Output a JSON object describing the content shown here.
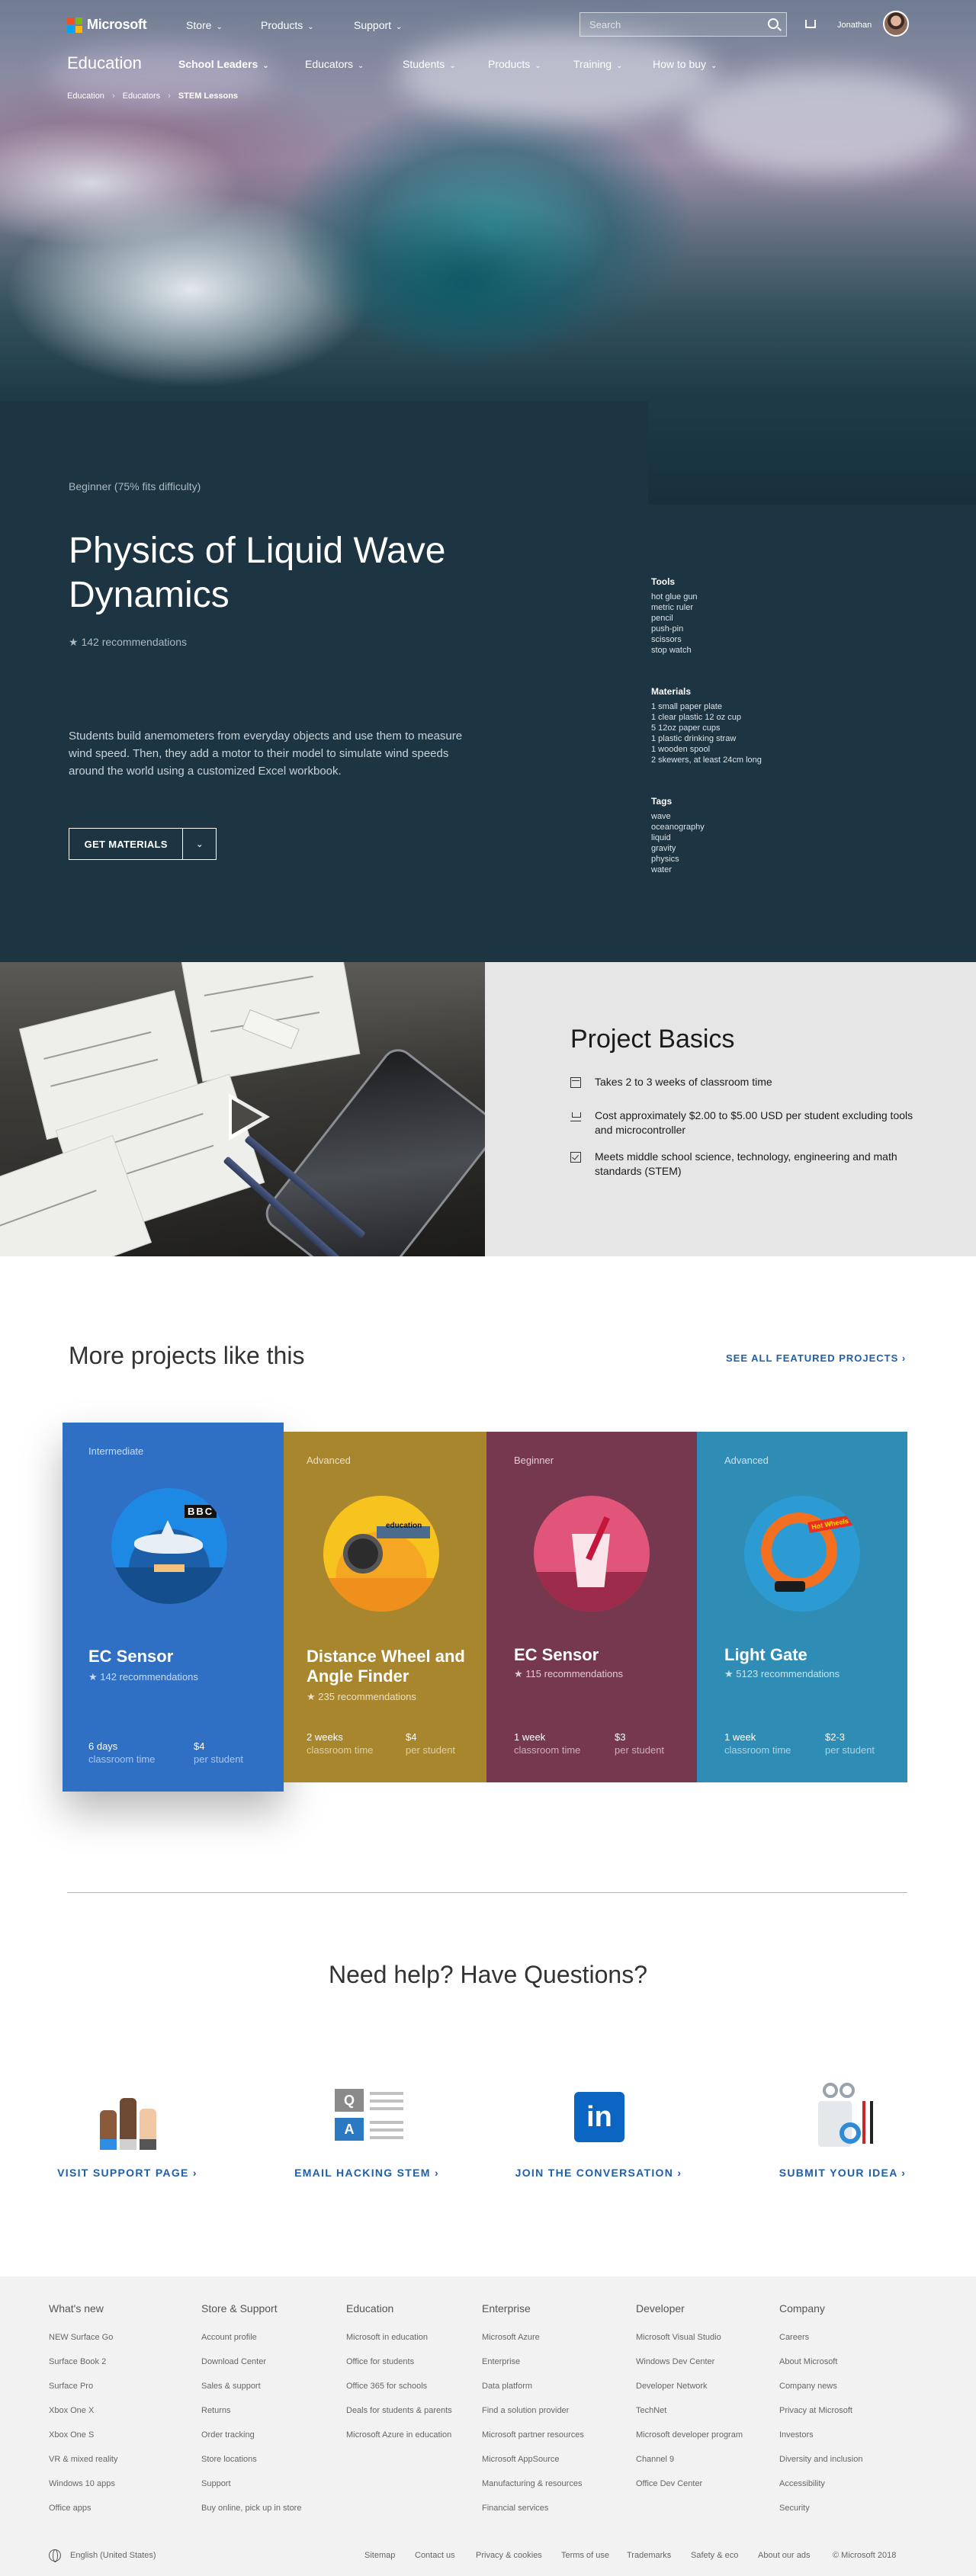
{
  "header": {
    "brand": "Microsoft",
    "logo_colors": [
      "#f25022",
      "#7fba00",
      "#00a4ef",
      "#ffb900"
    ],
    "top_links": [
      "Store",
      "Products",
      "Support"
    ],
    "search_placeholder": "Search",
    "user_name": "Jonathan",
    "section": "Education",
    "section_links": [
      "School Leaders",
      "Educators",
      "Students",
      "Products",
      "Training",
      "How to buy"
    ],
    "breadcrumb": [
      "Education",
      "Educators",
      "STEM Lessons"
    ]
  },
  "intro": {
    "difficulty": "Beginner (75% fits difficulty)",
    "title": "Physics of Liquid Wave Dynamics",
    "recommendations": "142 recommendations",
    "description": "Students build anemometers from everyday objects and use them to measure wind speed. Then, they add a motor to their model to simulate wind speeds around the world using a customized Excel workbook.",
    "cta": "GET MATERIALS",
    "tools_heading": "Tools",
    "tools": [
      "hot glue gun",
      "metric ruler",
      "pencil",
      "push-pin",
      "scissors",
      "stop watch"
    ],
    "materials_heading": "Materials",
    "materials": [
      "1 small paper plate",
      "1 clear plastic 12 oz cup",
      "5 12oz paper cups",
      "1 plastic drinking straw",
      "1 wooden spool",
      "2 skewers, at least 24cm long"
    ],
    "tags_heading": "Tags",
    "tags": [
      "wave",
      "oceanography",
      "liquid",
      "gravity",
      "physics",
      "water"
    ]
  },
  "basics": {
    "title": "Project Basics",
    "items": [
      {
        "icon": "calendar-icon",
        "text": "Takes 2 to 3 weeks of classroom time"
      },
      {
        "icon": "cart-icon",
        "text": "Cost approximately $2.00 to $5.00 USD per student excluding tools and microcontroller"
      },
      {
        "icon": "checkbox-icon",
        "text": "Meets middle school science, technology, engineering and math standards (STEM)"
      }
    ]
  },
  "more": {
    "title": "More projects like this",
    "see_all": "SEE ALL FEATURED PROJECTS",
    "cards": [
      {
        "level": "Intermediate",
        "title": "EC Sensor",
        "recs": "142 recommendations",
        "time": "6 days",
        "time_label": "classroom time",
        "cost": "$4",
        "cost_label": "per student",
        "color": "#2f6fc4",
        "badge": "BBC"
      },
      {
        "level": "Advanced",
        "title": "Distance Wheel and Angle Finder",
        "recs": "235 recommendations",
        "time": "2 weeks",
        "time_label": "classroom time",
        "cost": "$4",
        "cost_label": "per student",
        "color": "#a8862e",
        "badge": "education"
      },
      {
        "level": "Beginner",
        "title": "EC Sensor",
        "recs": "115 recommendations",
        "time": "1 week",
        "time_label": "classroom time",
        "cost": "$3",
        "cost_label": "per student",
        "color": "#76384e"
      },
      {
        "level": "Advanced",
        "title": "Light Gate",
        "recs": "5123 recommendations",
        "time": "1 week",
        "time_label": "classroom time",
        "cost": "$2-3",
        "cost_label": "per student",
        "color": "#2f8db5",
        "badge": "Hot Wheels"
      }
    ]
  },
  "help": {
    "title": "Need help? Have Questions?",
    "links": [
      "VISIT SUPPORT PAGE",
      "EMAIL HACKING STEM",
      "JOIN THE CONVERSATION",
      "SUBMIT YOUR IDEA"
    ],
    "qa_letters": [
      "Q",
      "A"
    ],
    "linkedin_text": "in"
  },
  "footer": {
    "columns": [
      {
        "heading": "What's new",
        "items": [
          "NEW Surface Go",
          "Surface Book 2",
          "Surface Pro",
          "Xbox One X",
          "Xbox One S",
          "VR & mixed reality",
          "Windows 10 apps",
          "Office apps"
        ]
      },
      {
        "heading": "Store & Support",
        "items": [
          "Account profile",
          "Download Center",
          "Sales & support",
          "Returns",
          "Order tracking",
          "Store locations",
          "Support",
          "Buy online, pick up in store"
        ]
      },
      {
        "heading": "Education",
        "items": [
          "Microsoft in education",
          "Office for students",
          "Office 365 for schools",
          "Deals for students & parents",
          "Microsoft Azure in education"
        ]
      },
      {
        "heading": "Enterprise",
        "items": [
          "Microsoft Azure",
          "Enterprise",
          "Data platform",
          "Find a solution provider",
          "Microsoft partner resources",
          "Microsoft AppSource",
          "Manufacturing & resources",
          "Financial services"
        ]
      },
      {
        "heading": "Developer",
        "items": [
          "Microsoft Visual Studio",
          "Windows Dev Center",
          "Developer Network",
          "TechNet",
          "Microsoft developer program",
          "Channel 9",
          "Office Dev Center"
        ]
      },
      {
        "heading": "Company",
        "items": [
          "Careers",
          "About Microsoft",
          "Company news",
          "Privacy at Microsoft",
          "Investors",
          "Diversity and inclusion",
          "Accessibility",
          "Security"
        ]
      }
    ],
    "locale": "English (United States)",
    "links": [
      "Sitemap",
      "Contact us",
      "Privacy & cookies",
      "Terms of use",
      "Trademarks",
      "Safety & eco",
      "About our ads",
      "© Microsoft 2018"
    ]
  }
}
